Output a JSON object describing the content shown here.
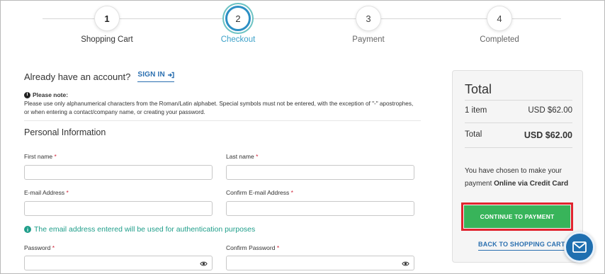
{
  "stepper": {
    "steps": [
      {
        "number": "1",
        "label": "Shopping Cart"
      },
      {
        "number": "2",
        "label": "Checkout"
      },
      {
        "number": "3",
        "label": "Payment"
      },
      {
        "number": "4",
        "label": "Completed"
      }
    ],
    "active_step": 2
  },
  "account": {
    "question": "Already have an account?",
    "sign_in": "SIGN IN"
  },
  "note": {
    "title": "Please note:",
    "line1": "Please use only alphanumerical characters from the Roman/Latin alphabet. Special symbols must not be entered, with the exception of \"-\" apostrophes,",
    "line2": "or when entering a contact/company name, or creating your password."
  },
  "personal": {
    "title": "Personal Information",
    "first_name_label": "First name",
    "last_name_label": "Last name",
    "email_label": "E-mail Address",
    "confirm_email_label": "Confirm E-mail Address",
    "password_label": "Password",
    "confirm_password_label": "Confirm Password",
    "required_mark": "*",
    "first_name_value": "",
    "last_name_value": "",
    "email_value": "",
    "confirm_email_value": "",
    "password_value": "",
    "confirm_password_value": "",
    "auth_note": "The email address entered will be used for authentication purposes"
  },
  "summary": {
    "title": "Total",
    "items_label": "1 item",
    "items_amount": "USD $62.00",
    "total_label": "Total",
    "total_amount": "USD $62.00",
    "chosen_prefix": "You have chosen to make your payment",
    "chosen_method": "Online via Credit Card",
    "continue_button": "CONTINUE TO PAYMENT",
    "back_link": "BACK TO SHOPPING CART"
  },
  "colors": {
    "accent_blue": "#2a6fb0",
    "active_step": "#3aa0c8",
    "cta_green": "#38b45a",
    "highlight_red": "#e0252f",
    "note_teal": "#1f9e8a"
  },
  "icons": {
    "sign_in": "sign-in-icon",
    "info": "info-icon",
    "eye": "eye-icon",
    "mail": "mail-icon"
  }
}
